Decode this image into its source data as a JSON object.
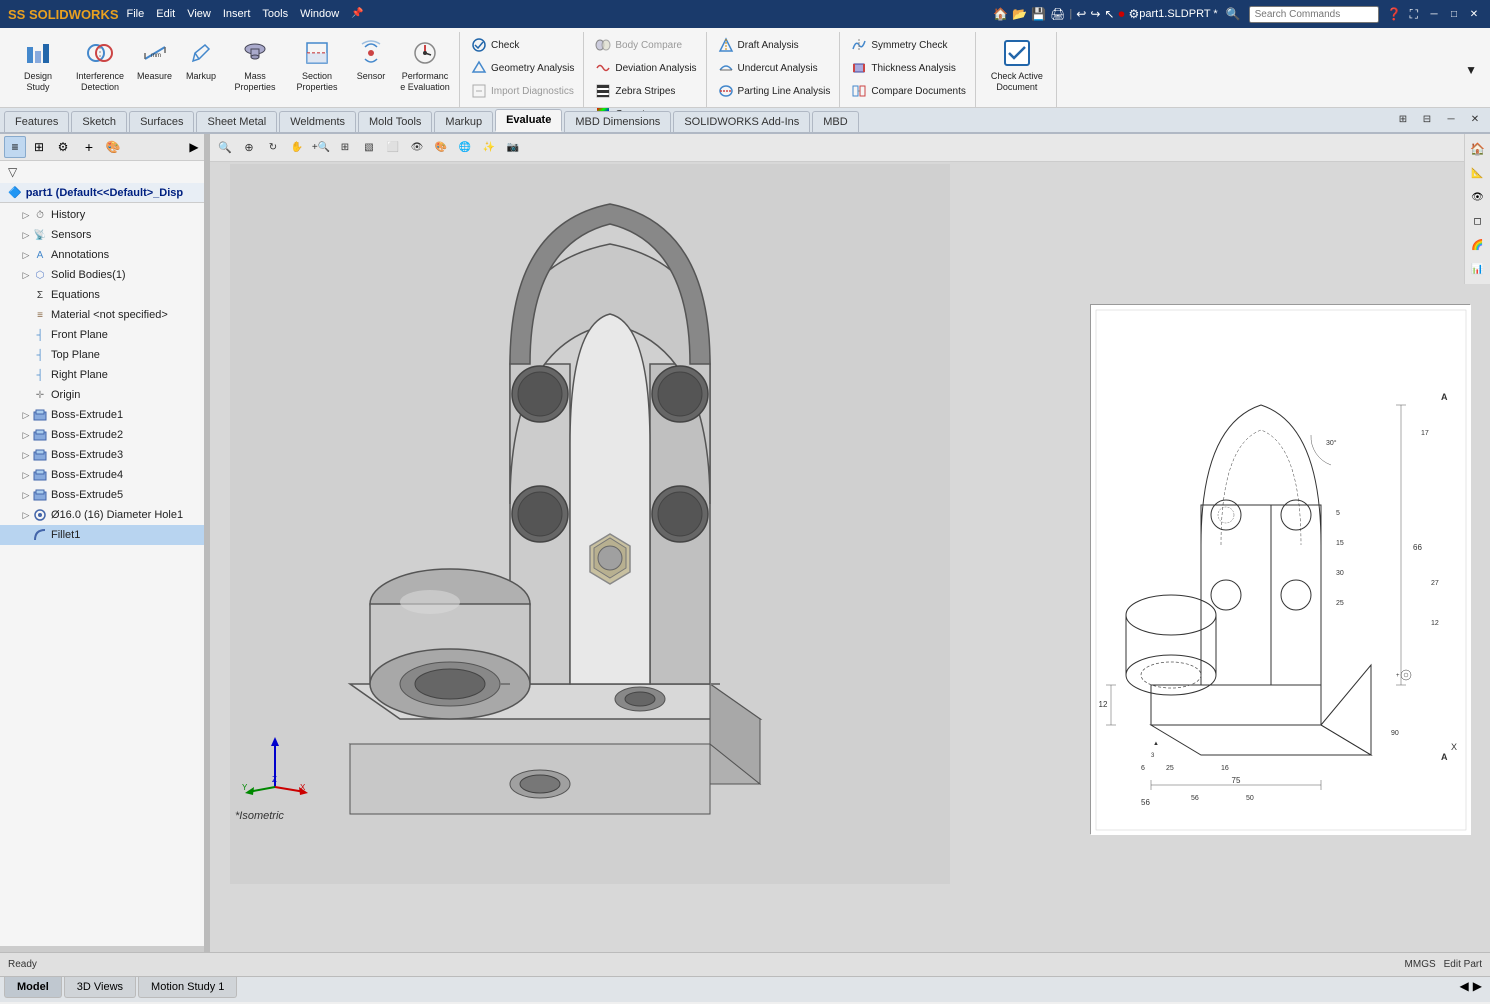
{
  "app": {
    "name": "SOLIDWORKS",
    "title": "part1.SLDPRT *",
    "logo_text": "SS SOLIDWORKS"
  },
  "menu": {
    "items": [
      "File",
      "Edit",
      "View",
      "Insert",
      "Tools",
      "Window"
    ]
  },
  "title_bar": {
    "search_placeholder": "Search Commands",
    "window_controls": [
      "─",
      "□",
      "✕"
    ]
  },
  "toolbar": {
    "groups": [
      {
        "name": "design-study",
        "buttons": [
          {
            "id": "design-study",
            "label": "Design Study",
            "icon": "📊"
          },
          {
            "id": "interference-detection",
            "label": "Interference Detection",
            "icon": "⚙"
          },
          {
            "id": "measure",
            "label": "Measure",
            "icon": "📏"
          },
          {
            "id": "markup",
            "label": "Markup",
            "icon": "✏"
          },
          {
            "id": "mass-properties",
            "label": "Mass Properties",
            "icon": "⚖"
          },
          {
            "id": "section-properties",
            "label": "Section Properties",
            "icon": "▦"
          },
          {
            "id": "sensor",
            "label": "Sensor",
            "icon": "📡"
          },
          {
            "id": "performance-evaluation",
            "label": "Performance Evaluation",
            "icon": "⚡"
          }
        ]
      }
    ],
    "check_group": {
      "check": "Check",
      "geometry_analysis": "Geometry Analysis",
      "import_diagnostics": "Import Diagnostics"
    },
    "body_compare_group": {
      "body_compare": "Body Compare",
      "deviation_analysis": "Deviation Analysis",
      "zebra_stripes": "Zebra Stripes",
      "curvature": "Curvature"
    },
    "draft_group": {
      "draft_analysis": "Draft Analysis",
      "undercut_analysis": "Undercut Analysis",
      "parting_line_analysis": "Parting Line Analysis"
    },
    "symmetry_group": {
      "symmetry_check": "Symmetry Check",
      "thickness_analysis": "Thickness Analysis",
      "compare_documents": "Compare Documents"
    },
    "check_active": "Check Active Document"
  },
  "tabs": {
    "items": [
      "Features",
      "Sketch",
      "Surfaces",
      "Sheet Metal",
      "Weldments",
      "Mold Tools",
      "Markup",
      "Evaluate",
      "MBD Dimensions",
      "SOLIDWORKS Add-Ins",
      "MBD"
    ],
    "active": "Evaluate"
  },
  "tree": {
    "part_title": "part1  (Default<<Default>_Disp",
    "items": [
      {
        "id": "history",
        "label": "History",
        "indent": 1,
        "icon": "H",
        "has_expander": false
      },
      {
        "id": "sensors",
        "label": "Sensors",
        "indent": 1,
        "icon": "S",
        "has_expander": false
      },
      {
        "id": "annotations",
        "label": "Annotations",
        "indent": 1,
        "icon": "A",
        "has_expander": false
      },
      {
        "id": "solid-bodies",
        "label": "Solid Bodies(1)",
        "indent": 1,
        "icon": "B",
        "has_expander": false
      },
      {
        "id": "equations",
        "label": "Equations",
        "indent": 1,
        "icon": "=",
        "has_expander": false
      },
      {
        "id": "material",
        "label": "Material <not specified>",
        "indent": 1,
        "icon": "M",
        "has_expander": false
      },
      {
        "id": "front-plane",
        "label": "Front Plane",
        "indent": 1,
        "icon": "P",
        "has_expander": false
      },
      {
        "id": "top-plane",
        "label": "Top Plane",
        "indent": 1,
        "icon": "P",
        "has_expander": false
      },
      {
        "id": "right-plane",
        "label": "Right Plane",
        "indent": 1,
        "icon": "P",
        "has_expander": false
      },
      {
        "id": "origin",
        "label": "Origin",
        "indent": 1,
        "icon": "+",
        "has_expander": false
      },
      {
        "id": "boss-extrude1",
        "label": "Boss-Extrude1",
        "indent": 1,
        "icon": "E",
        "has_expander": false
      },
      {
        "id": "boss-extrude2",
        "label": "Boss-Extrude2",
        "indent": 1,
        "icon": "E",
        "has_expander": false
      },
      {
        "id": "boss-extrude3",
        "label": "Boss-Extrude3",
        "indent": 1,
        "icon": "E",
        "has_expander": false
      },
      {
        "id": "boss-extrude4",
        "label": "Boss-Extrude4",
        "indent": 1,
        "icon": "E",
        "has_expander": false
      },
      {
        "id": "boss-extrude5",
        "label": "Boss-Extrude5",
        "indent": 1,
        "icon": "E",
        "has_expander": false
      },
      {
        "id": "hole1",
        "label": "Ø16.0 (16) Diameter Hole1",
        "indent": 1,
        "icon": "H",
        "has_expander": false
      },
      {
        "id": "fillet1",
        "label": "Fillet1",
        "indent": 1,
        "icon": "F",
        "has_expander": false,
        "selected": true
      }
    ]
  },
  "viewport": {
    "label": "*Isometric",
    "bg_color": "#c8c8c8"
  },
  "status_tabs": {
    "items": [
      "Model",
      "3D Views",
      "Motion Study 1"
    ],
    "active": "Model"
  },
  "view_toolbar": {
    "buttons": [
      "🔍",
      "🔎",
      "◉",
      "⊕",
      "🔄",
      "↩",
      "🎯",
      "⬜",
      "⬛",
      "🔲",
      "🌐",
      "💡",
      "🎨",
      "📷",
      "▶"
    ]
  },
  "right_panel": {
    "buttons": [
      "🏠",
      "📋",
      "📐",
      "🎯",
      "🌈",
      "📊"
    ]
  }
}
